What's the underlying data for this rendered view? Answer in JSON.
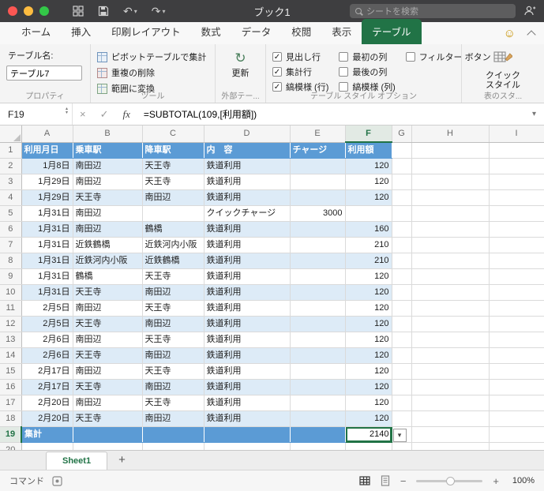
{
  "colors": {
    "excel_green": "#217346",
    "table_header_blue": "#5B9BD5",
    "band_row_blue": "#DDEBF7"
  },
  "icons": {
    "dropdown_glyph": "▾",
    "up_glyph": "▴",
    "check_glyph": "✓",
    "close_glyph": "×",
    "smiley_glyph": "☺",
    "undo_glyph": "↶",
    "redo_glyph": "↷",
    "refresh_glyph": "↻",
    "minus_glyph": "−",
    "plus_glyph": "+"
  },
  "titlebar": {
    "title": "ブック1",
    "search_placeholder": "シートを検索"
  },
  "tab_row": {
    "tabs": [
      {
        "label": "ホーム",
        "key": "home",
        "active": false
      },
      {
        "label": "挿入",
        "key": "insert",
        "active": false
      },
      {
        "label": "印刷レイアウト",
        "key": "page-layout",
        "active": false
      },
      {
        "label": "数式",
        "key": "formulas",
        "active": false
      },
      {
        "label": "データ",
        "key": "data",
        "active": false
      },
      {
        "label": "校閲",
        "key": "review",
        "active": false
      },
      {
        "label": "表示",
        "key": "view",
        "active": false
      },
      {
        "label": "テーブル",
        "key": "table",
        "active": true
      }
    ]
  },
  "ribbon": {
    "properties_group": {
      "table_name_label": "テーブル名:",
      "table_name_value": "テーブル7",
      "group_label": "プロパティ"
    },
    "tools_group": {
      "buttons": [
        {
          "label": "ピボットテーブルで集計",
          "key": "summarize-with-pivot"
        },
        {
          "label": "重複の削除",
          "key": "remove-duplicates"
        },
        {
          "label": "範囲に変換",
          "key": "convert-to-range"
        }
      ],
      "group_label": "ツール"
    },
    "external_group": {
      "refresh_label": "更新",
      "group_label": "外部テー..."
    },
    "style_options_group": {
      "columns": [
        [
          {
            "label": "見出し行",
            "key": "header-row",
            "checked": true
          },
          {
            "label": "集計行",
            "key": "total-row",
            "checked": true
          },
          {
            "label": "縞模様 (行)",
            "key": "banded-rows",
            "checked": true
          }
        ],
        [
          {
            "label": "最初の列",
            "key": "first-column",
            "checked": false
          },
          {
            "label": "最後の列",
            "key": "last-column",
            "checked": false
          },
          {
            "label": "縞模様 (列)",
            "key": "banded-columns",
            "checked": false
          }
        ],
        [
          {
            "label": "フィルター ボタン",
            "key": "filter-button",
            "checked": false
          }
        ]
      ],
      "group_label": "テーブル スタイル オプション"
    },
    "quick_style_group": {
      "button_label": "クイック\nスタイル",
      "group_label": "表のスタ..."
    }
  },
  "formula_bar": {
    "cell_ref": "F19",
    "fx_label": "fx",
    "formula": "=SUBTOTAL(109,[利用額])"
  },
  "grid": {
    "column_letters": [
      "A",
      "B",
      "C",
      "D",
      "E",
      "F",
      "G",
      "H",
      "I"
    ],
    "selected_column": "F",
    "selected_row": "19",
    "rows": [
      {
        "n": 1,
        "type": "header",
        "cells": [
          "利用月日",
          "乗車駅",
          "降車駅",
          "内　容",
          "チャージ",
          "利用額"
        ]
      },
      {
        "n": 2,
        "type": "data",
        "cells": [
          "1月8日",
          "南田辺",
          "天王寺",
          "鉄道利用",
          "",
          "120"
        ]
      },
      {
        "n": 3,
        "type": "data",
        "cells": [
          "1月29日",
          "南田辺",
          "天王寺",
          "鉄道利用",
          "",
          "120"
        ]
      },
      {
        "n": 4,
        "type": "data",
        "cells": [
          "1月29日",
          "天王寺",
          "南田辺",
          "鉄道利用",
          "",
          "120"
        ]
      },
      {
        "n": 5,
        "type": "data",
        "cells": [
          "1月31日",
          "南田辺",
          "",
          "クイックチャージ",
          "3000",
          ""
        ]
      },
      {
        "n": 6,
        "type": "data",
        "cells": [
          "1月31日",
          "南田辺",
          "鶴橋",
          "鉄道利用",
          "",
          "160"
        ]
      },
      {
        "n": 7,
        "type": "data",
        "cells": [
          "1月31日",
          "近鉄鶴橋",
          "近鉄河内小阪",
          "鉄道利用",
          "",
          "210"
        ]
      },
      {
        "n": 8,
        "type": "data",
        "cells": [
          "1月31日",
          "近鉄河内小阪",
          "近鉄鶴橋",
          "鉄道利用",
          "",
          "210"
        ]
      },
      {
        "n": 9,
        "type": "data",
        "cells": [
          "1月31日",
          "鶴橋",
          "天王寺",
          "鉄道利用",
          "",
          "120"
        ]
      },
      {
        "n": 10,
        "type": "data",
        "cells": [
          "1月31日",
          "天王寺",
          "南田辺",
          "鉄道利用",
          "",
          "120"
        ]
      },
      {
        "n": 11,
        "type": "data",
        "cells": [
          "2月5日",
          "南田辺",
          "天王寺",
          "鉄道利用",
          "",
          "120"
        ]
      },
      {
        "n": 12,
        "type": "data",
        "cells": [
          "2月5日",
          "天王寺",
          "南田辺",
          "鉄道利用",
          "",
          "120"
        ]
      },
      {
        "n": 13,
        "type": "data",
        "cells": [
          "2月6日",
          "南田辺",
          "天王寺",
          "鉄道利用",
          "",
          "120"
        ]
      },
      {
        "n": 14,
        "type": "data",
        "cells": [
          "2月6日",
          "天王寺",
          "南田辺",
          "鉄道利用",
          "",
          "120"
        ]
      },
      {
        "n": 15,
        "type": "data",
        "cells": [
          "2月17日",
          "南田辺",
          "天王寺",
          "鉄道利用",
          "",
          "120"
        ]
      },
      {
        "n": 16,
        "type": "data",
        "cells": [
          "2月17日",
          "天王寺",
          "南田辺",
          "鉄道利用",
          "",
          "120"
        ]
      },
      {
        "n": 17,
        "type": "data",
        "cells": [
          "2月20日",
          "南田辺",
          "天王寺",
          "鉄道利用",
          "",
          "120"
        ]
      },
      {
        "n": 18,
        "type": "data",
        "cells": [
          "2月20日",
          "天王寺",
          "南田辺",
          "鉄道利用",
          "",
          "120"
        ]
      },
      {
        "n": 19,
        "type": "total",
        "cells": [
          "集計",
          "",
          "",
          "",
          "",
          "2140"
        ]
      },
      {
        "n": 20,
        "type": "empty",
        "cells": [
          "",
          "",
          "",
          "",
          "",
          ""
        ]
      }
    ]
  },
  "sheet_bar": {
    "active_tab": "Sheet1",
    "add_tab": "+"
  },
  "status_bar": {
    "left_label": "コマンド",
    "zoom": "100%"
  }
}
